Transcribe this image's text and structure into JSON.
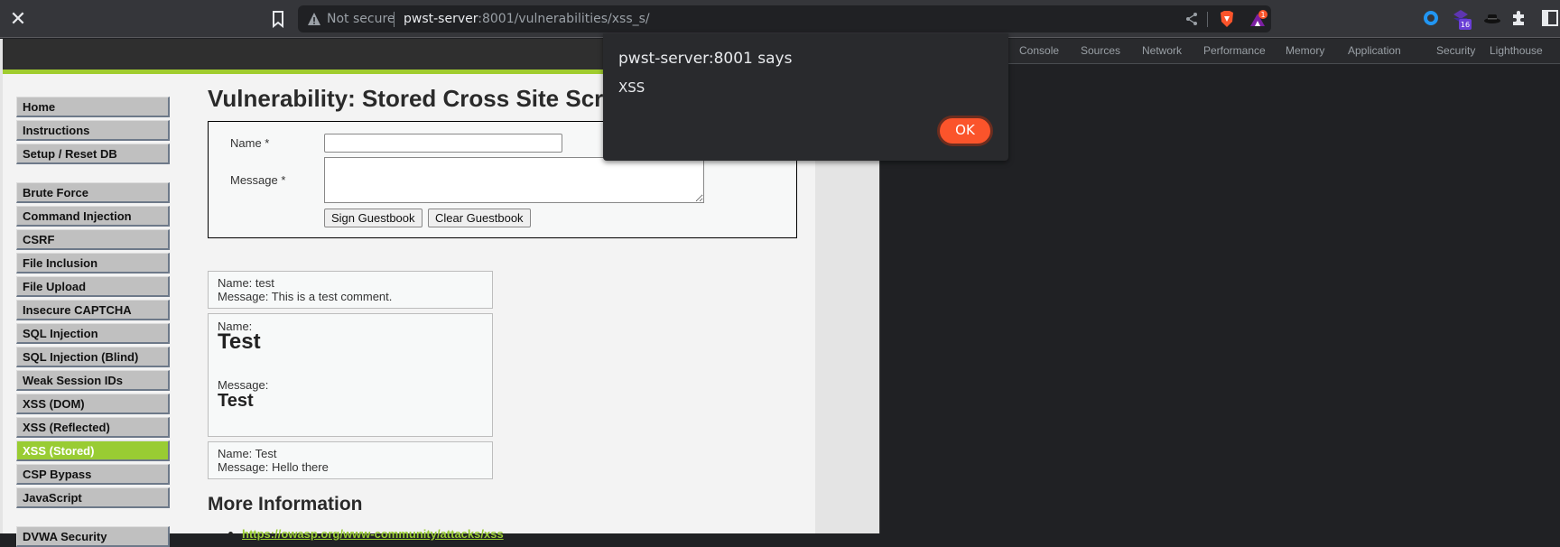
{
  "browser": {
    "close_glyph": "✕",
    "security_label": "Not secure",
    "url_host": "pwst-server",
    "url_rest": ":8001/vulnerabilities/xss_s/",
    "rewards_badge": "1",
    "extension_badge": "16"
  },
  "dialog": {
    "title": "pwst-server:8001 says",
    "message": "XSS",
    "ok_label": "OK"
  },
  "sidebar": {
    "items": [
      {
        "label": "Home"
      },
      {
        "label": "Instructions"
      },
      {
        "label": "Setup / Reset DB"
      },
      {
        "label": "Brute Force"
      },
      {
        "label": "Command Injection"
      },
      {
        "label": "CSRF"
      },
      {
        "label": "File Inclusion"
      },
      {
        "label": "File Upload"
      },
      {
        "label": "Insecure CAPTCHA"
      },
      {
        "label": "SQL Injection"
      },
      {
        "label": "SQL Injection (Blind)"
      },
      {
        "label": "Weak Session IDs"
      },
      {
        "label": "XSS (DOM)"
      },
      {
        "label": "XSS (Reflected)"
      },
      {
        "label": "XSS (Stored)",
        "selected": true
      },
      {
        "label": "CSP Bypass"
      },
      {
        "label": "JavaScript"
      },
      {
        "label": "DVWA Security"
      }
    ]
  },
  "main": {
    "title": "Vulnerability: Stored Cross Site Scripting (XSS)",
    "form": {
      "name_label": "Name *",
      "name_value": "",
      "message_label": "Message *",
      "message_value": "",
      "sign_button": "Sign Guestbook",
      "clear_button": "Clear Guestbook"
    },
    "entries": [
      {
        "name_line": "Name: test",
        "message_line": "Message: This is a test comment."
      },
      {
        "name_label": "Name:",
        "name_value": "Test",
        "message_label": "Message:",
        "message_value": "Test"
      },
      {
        "name_line": "Name: Test",
        "message_line": "Message: Hello there"
      }
    ],
    "more_info_heading": "More Information",
    "links": [
      "https://owasp.org/www-community/attacks/xss"
    ]
  },
  "devtools": {
    "tabs": [
      "Console",
      "Sources",
      "Network",
      "Performance",
      "Memory",
      "Application",
      "Security",
      "Lighthouse"
    ]
  },
  "colors": {
    "accent_green": "#a0cc2e",
    "selected_menu": "#99cc33",
    "ok_button": "#fb542b"
  }
}
